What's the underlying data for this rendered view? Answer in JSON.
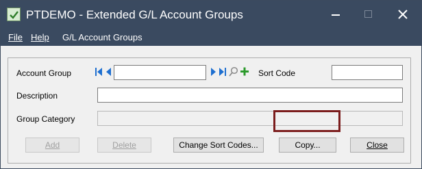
{
  "window": {
    "title": "PTDEMO - Extended G/L Account Groups",
    "controls": {
      "minimize": "minimize",
      "maximize": "maximize",
      "close": "close"
    }
  },
  "menu": {
    "items": [
      {
        "label": "File"
      },
      {
        "label": "Help"
      },
      {
        "label": "G/L Account Groups"
      }
    ]
  },
  "form": {
    "account_group_label": "Account Group",
    "account_group_value": "",
    "sort_code_label": "Sort Code",
    "sort_code_value": "",
    "description_label": "Description",
    "description_value": "",
    "group_category_label": "Group Category",
    "group_category_value": ""
  },
  "buttons": {
    "add": "Add",
    "delete": "Delete",
    "change_sort_codes": "Change Sort Codes...",
    "copy": "Copy...",
    "close": "Close"
  },
  "icons": {
    "app": "account-groups-app-icon",
    "first": "first-record-icon",
    "previous": "previous-record-icon",
    "next": "next-record-icon",
    "last": "last-record-icon",
    "finder": "finder-magnifier-icon",
    "new": "new-record-plus-icon"
  },
  "colors": {
    "titlebar": "#3a4a60",
    "nav_arrow": "#1e6fd0",
    "plus": "#2c9a2c",
    "highlight_box": "#7b1c1c"
  }
}
